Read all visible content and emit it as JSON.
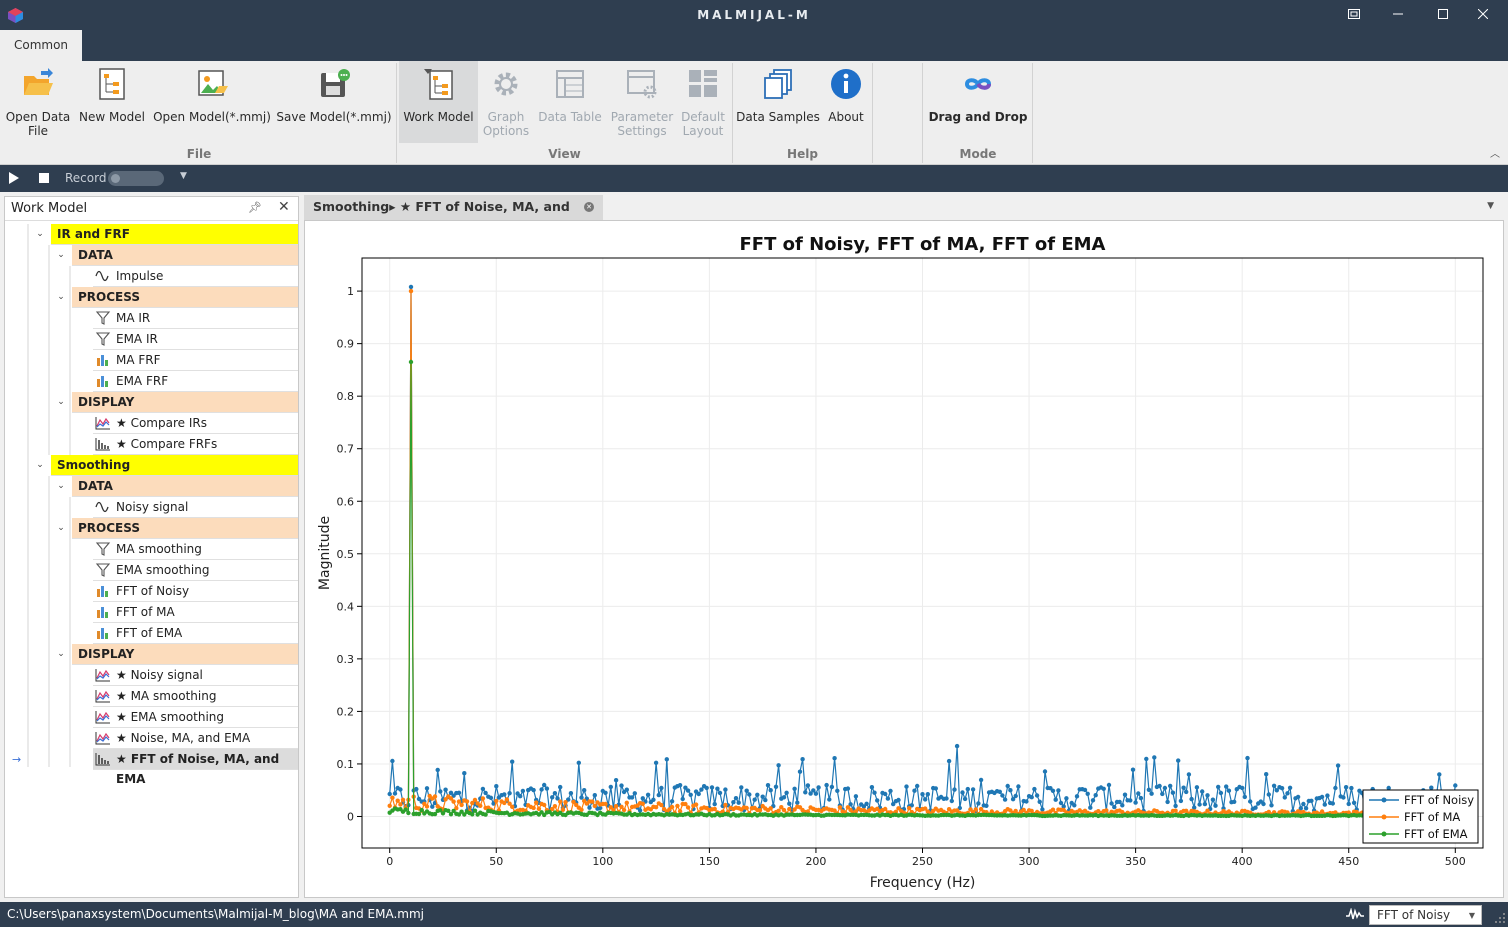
{
  "titlebar": {
    "title": "MALMIJAL-M"
  },
  "tabs": [
    {
      "label": "Common"
    }
  ],
  "ribbon": {
    "file_group": "File",
    "view_group": "View",
    "help_group": "Help",
    "mode_group": "Mode",
    "buttons": {
      "open_data": "Open Data\nFile",
      "new_model": "New Model",
      "open_model": "Open Model(*.mmj)",
      "save_model": "Save Model(*.mmj)",
      "work_model": "Work Model",
      "graph_options": "Graph\nOptions",
      "data_table": "Data Table",
      "parameter_settings": "Parameter\nSettings",
      "default_layout": "Default\nLayout",
      "data_samples": "Data Samples",
      "about": "About",
      "drag_drop": "Drag and Drop"
    }
  },
  "recordbar": {
    "record_label": "Record"
  },
  "panel": {
    "title": "Work Model"
  },
  "tree": [
    {
      "kind": "group",
      "label": "IR and FRF"
    },
    {
      "kind": "cat",
      "label": "DATA"
    },
    {
      "kind": "leaf",
      "icon": "wave-icon",
      "label": "Impulse"
    },
    {
      "kind": "cat",
      "label": "PROCESS"
    },
    {
      "kind": "leaf",
      "icon": "filter-icon",
      "label": "MA IR"
    },
    {
      "kind": "leaf",
      "icon": "filter-icon",
      "label": "EMA IR"
    },
    {
      "kind": "leaf",
      "icon": "bar-chart-icon",
      "label": "MA FRF"
    },
    {
      "kind": "leaf",
      "icon": "bar-chart-icon",
      "label": "EMA FRF"
    },
    {
      "kind": "cat",
      "label": "DISPLAY"
    },
    {
      "kind": "leaf",
      "icon": "line-graph-icon",
      "label": "★ Compare IRs"
    },
    {
      "kind": "leaf",
      "icon": "spectrum-icon",
      "label": "★ Compare FRFs"
    },
    {
      "kind": "group",
      "label": "Smoothing"
    },
    {
      "kind": "cat",
      "label": "DATA"
    },
    {
      "kind": "leaf",
      "icon": "wave-icon",
      "label": "Noisy signal"
    },
    {
      "kind": "cat",
      "label": "PROCESS"
    },
    {
      "kind": "leaf",
      "icon": "filter-icon",
      "label": "MA smoothing"
    },
    {
      "kind": "leaf",
      "icon": "filter-icon",
      "label": "EMA smoothing"
    },
    {
      "kind": "leaf",
      "icon": "bar-chart-icon",
      "label": "FFT of Noisy"
    },
    {
      "kind": "leaf",
      "icon": "bar-chart-icon",
      "label": "FFT of MA"
    },
    {
      "kind": "leaf",
      "icon": "bar-chart-icon",
      "label": "FFT of EMA"
    },
    {
      "kind": "cat",
      "label": "DISPLAY"
    },
    {
      "kind": "leaf",
      "icon": "line-graph-icon",
      "label": "★ Noisy signal"
    },
    {
      "kind": "leaf",
      "icon": "line-graph-icon",
      "label": "★ MA smoothing"
    },
    {
      "kind": "leaf",
      "icon": "line-graph-icon",
      "label": "★ EMA smoothing"
    },
    {
      "kind": "leaf",
      "icon": "line-graph-icon",
      "label": "★ Noise, MA, and EMA"
    },
    {
      "kind": "leaf",
      "icon": "spectrum-icon",
      "label": "★ FFT of Noise, MA, and EMA",
      "selected": true
    }
  ],
  "document_tab": {
    "label": "Smoothing▸ ★ FFT of Noise, MA, and EMA"
  },
  "chart_data": {
    "type": "line",
    "title": "FFT of Noisy, FFT of MA, FFT of EMA",
    "xlabel": "Frequency (Hz)",
    "ylabel": "Magnitude",
    "xlim": [
      -13,
      513
    ],
    "ylim": [
      -0.06,
      1.063
    ],
    "xticks": [
      0,
      50,
      100,
      150,
      200,
      250,
      300,
      350,
      400,
      450,
      500
    ],
    "yticks": [
      0,
      0.1,
      0.2,
      0.3,
      0.4,
      0.5,
      0.6,
      0.7,
      0.8,
      0.9,
      1
    ],
    "grid": true,
    "legend": "bottom-right",
    "series": [
      {
        "name": "FFT of Noisy",
        "color": "#1f77b4",
        "peak": 1.008,
        "baseline": 0.03,
        "spread": 0.05
      },
      {
        "name": "FFT of MA",
        "color": "#ff7f0e",
        "peak": 1.0,
        "baseline": 0.02,
        "spread": 0.03
      },
      {
        "name": "FFT of EMA",
        "color": "#2ca02c",
        "peak": 0.865,
        "baseline": 0.008,
        "spread": 0.01
      }
    ]
  },
  "status": {
    "path": "C:\\Users\\panaxsystem\\Documents\\Malmijal-M_blog\\MA and EMA.mmj",
    "selected_view": "FFT of Noisy"
  }
}
